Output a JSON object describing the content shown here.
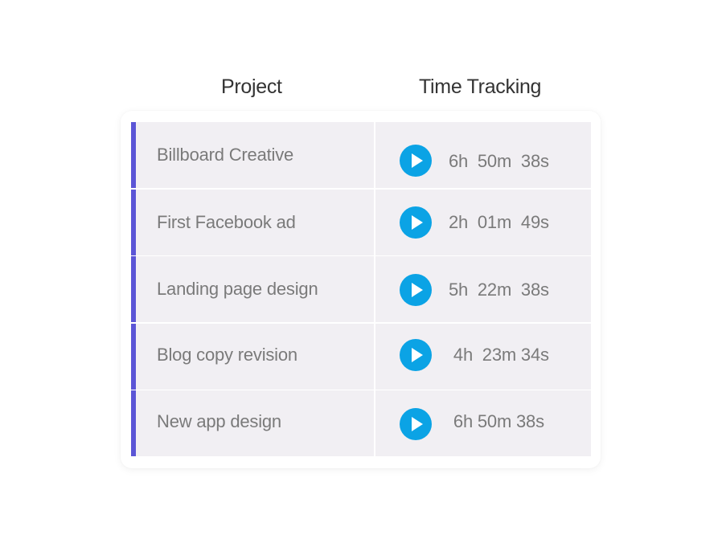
{
  "headers": {
    "project": "Project",
    "time_tracking": "Time Tracking"
  },
  "accent_color": "#5b55d6",
  "play_color": "#0ba3e5",
  "rows": [
    {
      "project": "Billboard Creative",
      "time": "6h  50m  38s",
      "icon": "play-icon"
    },
    {
      "project": "First Facebook ad",
      "time": "2h  01m  49s",
      "icon": "play-icon"
    },
    {
      "project": "Landing page design",
      "time": "5h  22m  38s",
      "icon": "play-icon"
    },
    {
      "project": "Blog copy revision",
      "time": " 4h  23m 34s",
      "icon": "play-icon"
    },
    {
      "project": "New app design",
      "time": " 6h 50m 38s",
      "icon": "play-icon"
    }
  ]
}
